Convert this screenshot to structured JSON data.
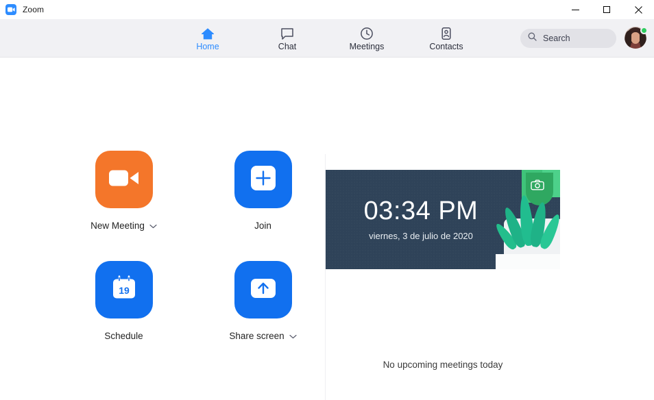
{
  "window": {
    "title": "Zoom",
    "app_icon": "video-camera-icon",
    "controls": {
      "minimize": "minimize-icon",
      "maximize": "maximize-icon",
      "close": "close-icon"
    }
  },
  "header": {
    "tabs": [
      {
        "label": "Home",
        "icon": "home-icon",
        "active": true
      },
      {
        "label": "Chat",
        "icon": "chat-bubble-icon",
        "active": false
      },
      {
        "label": "Meetings",
        "icon": "clock-icon",
        "active": false
      },
      {
        "label": "Contacts",
        "icon": "contact-card-icon",
        "active": false
      }
    ],
    "search": {
      "placeholder": "Search",
      "value": "",
      "icon": "search-icon"
    },
    "avatar": {
      "name": "avatar",
      "status": "available",
      "status_color": "#2ECC5F"
    }
  },
  "toolbar": {
    "settings_icon": "gear-icon",
    "annotation": {
      "type": "arrow",
      "color": "#E8201B",
      "points_to": "gear-icon"
    }
  },
  "main": {
    "actions": [
      {
        "label": "New Meeting",
        "icon": "video-camera-icon",
        "color": "#F4762A",
        "has_dropdown": true
      },
      {
        "label": "Join",
        "icon": "plus-icon",
        "color": "#1170EF",
        "has_dropdown": false
      },
      {
        "label": "Schedule",
        "icon": "calendar-icon",
        "color": "#1170EF",
        "has_dropdown": false
      },
      {
        "label": "Share screen",
        "icon": "up-arrow-icon",
        "color": "#1170EF",
        "has_dropdown": true
      }
    ],
    "schedule_icon_day": "19",
    "clock_card": {
      "time": "03:34 PM",
      "date": "viernes, 3 de julio de 2020",
      "background_color": "#2F4359",
      "camera_icon": "camera-icon"
    },
    "upcoming_meetings_empty": "No upcoming meetings today"
  },
  "colors": {
    "accent_blue": "#2D8CFF",
    "button_blue": "#1170EF",
    "button_orange": "#F4762A",
    "header_bg": "#F1F1F4",
    "card_bg": "#2F4359",
    "annotation_red": "#E8201B"
  }
}
